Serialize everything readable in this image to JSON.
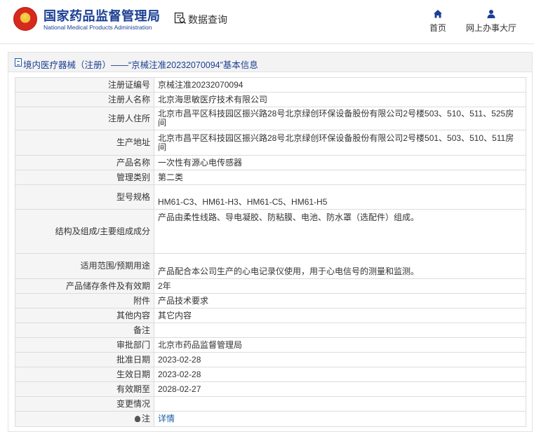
{
  "header": {
    "brand_cn": "国家药品监督管理局",
    "brand_en": "National Medical Products Administration",
    "query_label": "数据查询",
    "nav": [
      {
        "label": "首页",
        "icon": "home-icon"
      },
      {
        "label": "网上办事大厅",
        "icon": "user-icon"
      }
    ]
  },
  "colors": {
    "brand_blue": "#1a3f93",
    "link_blue": "#1a5ea8",
    "label_bg": "#f5f5f5"
  },
  "panel": {
    "title": "境内医疗器械（注册）——“京械注准20232070094”基本信息"
  },
  "rows": [
    {
      "label": "注册证编号",
      "value": "京械注准20232070094"
    },
    {
      "label": "注册人名称",
      "value": "北京海思敏医疗技术有限公司"
    },
    {
      "label": "注册人住所",
      "value": "北京市昌平区科技园区振兴路28号北京绿创环保设备股份有限公司2号楼503、510、511、525房间"
    },
    {
      "label": "生产地址",
      "value": "北京市昌平区科技园区振兴路28号北京绿创环保设备股份有限公司2号楼501、503、510、511房间"
    },
    {
      "label": "产品名称",
      "value": "一次性有源心电传感器"
    },
    {
      "label": "管理类别",
      "value": "第二类"
    },
    {
      "label": "型号规格",
      "value": "HM61-C3、HM61-H3、HM61-C5、HM61-H5"
    },
    {
      "label": "结构及组成/主要组成成分",
      "value": "产品由柔性线路、导电凝胶、防粘膜、电池、防水罩（选配件）组成。"
    },
    {
      "label": "适用范围/预期用途",
      "value": "产品配合本公司生产的心电记录仪使用，用于心电信号的测量和监测。"
    },
    {
      "label": "产品储存条件及有效期",
      "value": "2年"
    },
    {
      "label": "附件",
      "value": "产品技术要求"
    },
    {
      "label": "其他内容",
      "value": "其它内容"
    },
    {
      "label": "备注",
      "value": ""
    },
    {
      "label": "审批部门",
      "value": "北京市药品监督管理局"
    },
    {
      "label": "批准日期",
      "value": "2023-02-28"
    },
    {
      "label": "生效日期",
      "value": "2023-02-28"
    },
    {
      "label": "有效期至",
      "value": "2028-02-27"
    },
    {
      "label": "变更情况",
      "value": ""
    },
    {
      "label": "注",
      "value": "详情"
    }
  ]
}
